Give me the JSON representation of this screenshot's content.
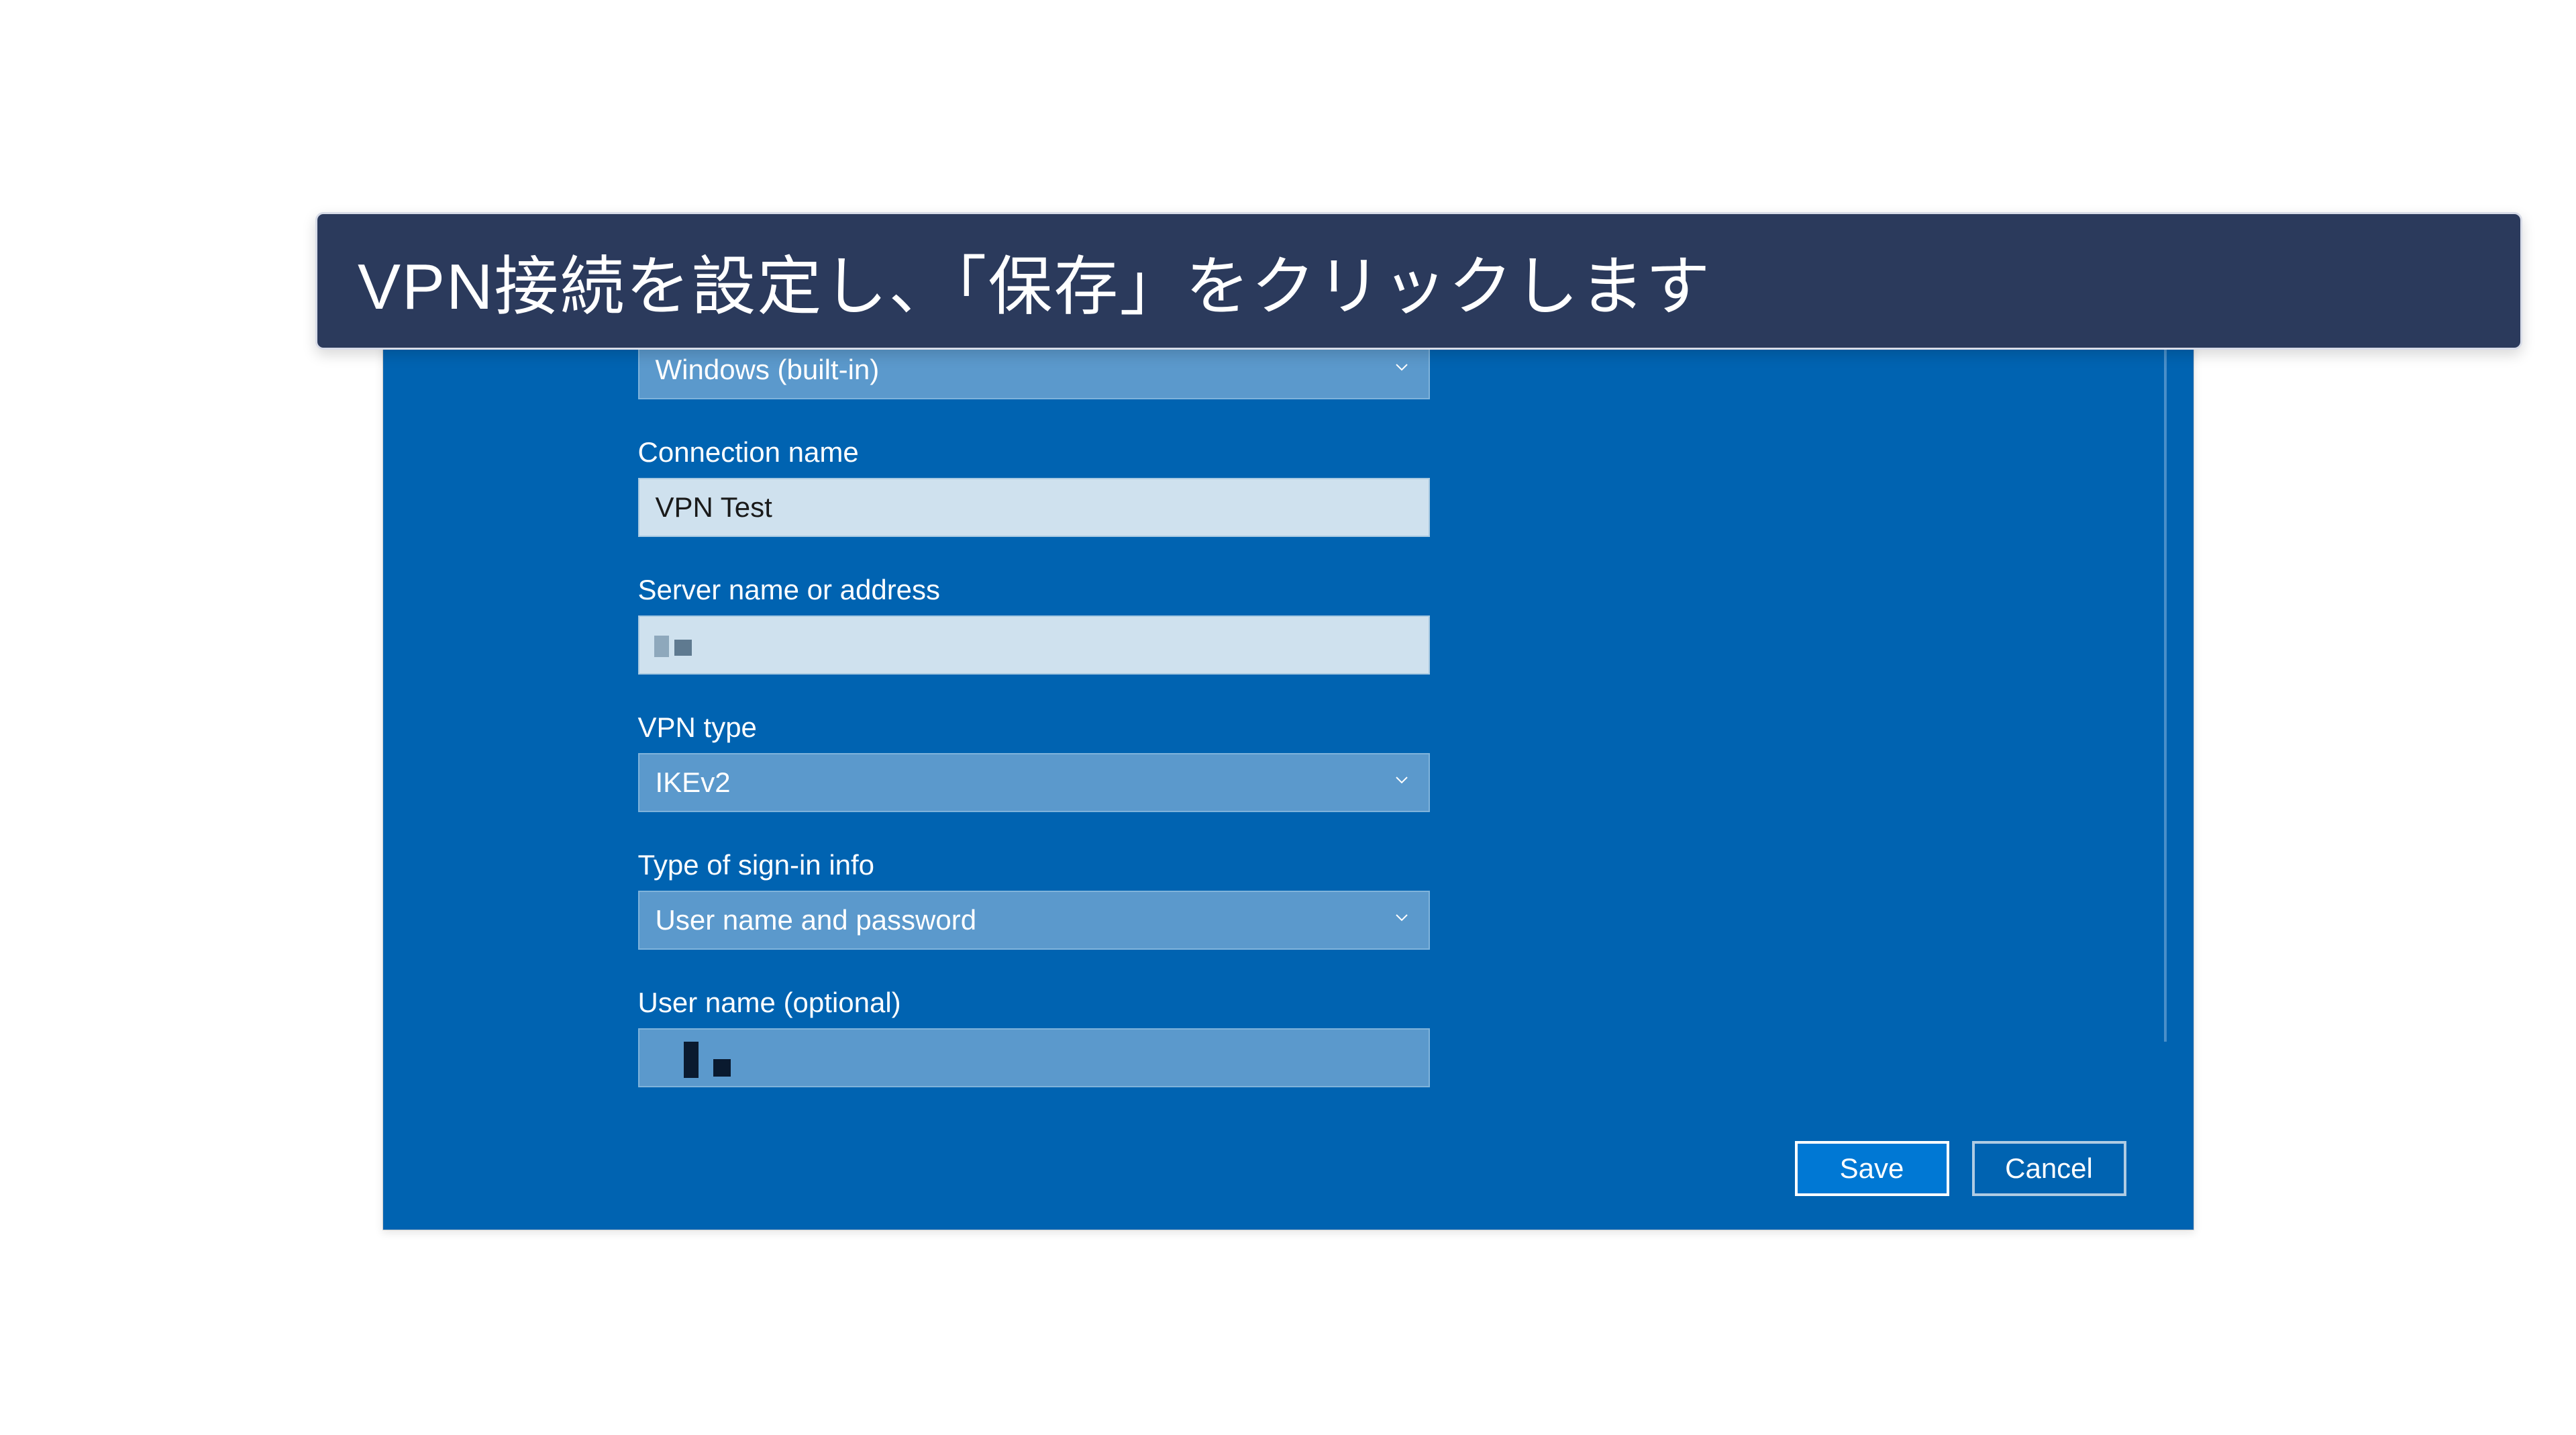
{
  "annotation": {
    "text": "VPN接続を設定し、「保存」をクリックします"
  },
  "form": {
    "provider": {
      "value": "Windows (built-in)"
    },
    "connection_name": {
      "label": "Connection name",
      "value": "VPN Test"
    },
    "server": {
      "label": "Server name or address",
      "value": ""
    },
    "vpn_type": {
      "label": "VPN type",
      "value": "IKEv2"
    },
    "signin_info": {
      "label": "Type of sign-in info",
      "value": "User name and password"
    },
    "username": {
      "label": "User name (optional)",
      "value": ""
    }
  },
  "buttons": {
    "save": "Save",
    "cancel": "Cancel"
  }
}
